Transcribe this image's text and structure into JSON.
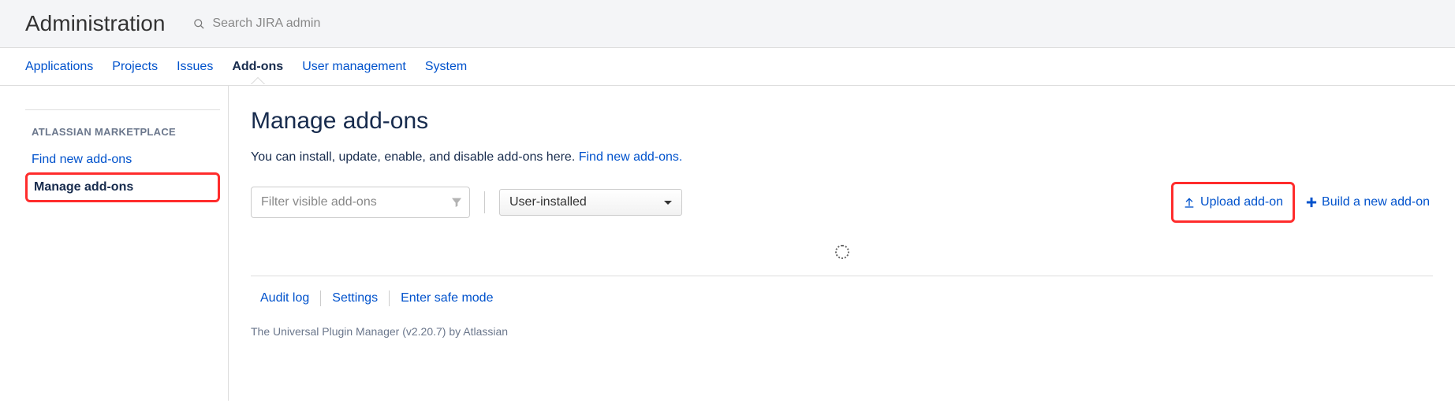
{
  "header": {
    "title": "Administration",
    "search_placeholder": "Search JIRA admin"
  },
  "tabs": [
    {
      "label": "Applications",
      "active": false
    },
    {
      "label": "Projects",
      "active": false
    },
    {
      "label": "Issues",
      "active": false
    },
    {
      "label": "Add-ons",
      "active": true
    },
    {
      "label": "User management",
      "active": false
    },
    {
      "label": "System",
      "active": false
    }
  ],
  "sidebar": {
    "heading": "ATLASSIAN MARKETPLACE",
    "items": [
      {
        "label": "Find new add-ons",
        "active": false
      },
      {
        "label": "Manage add-ons",
        "active": true
      }
    ]
  },
  "main": {
    "title": "Manage add-ons",
    "desc_text": "You can install, update, enable, and disable add-ons here. ",
    "desc_link": "Find new add-ons.",
    "filter_placeholder": "Filter visible add-ons",
    "select_value": "User-installed",
    "upload_label": "Upload add-on",
    "build_label": "Build a new add-on"
  },
  "footer": {
    "links": [
      "Audit log",
      "Settings",
      "Enter safe mode"
    ],
    "text": "The Universal Plugin Manager (v2.20.7) by Atlassian"
  }
}
